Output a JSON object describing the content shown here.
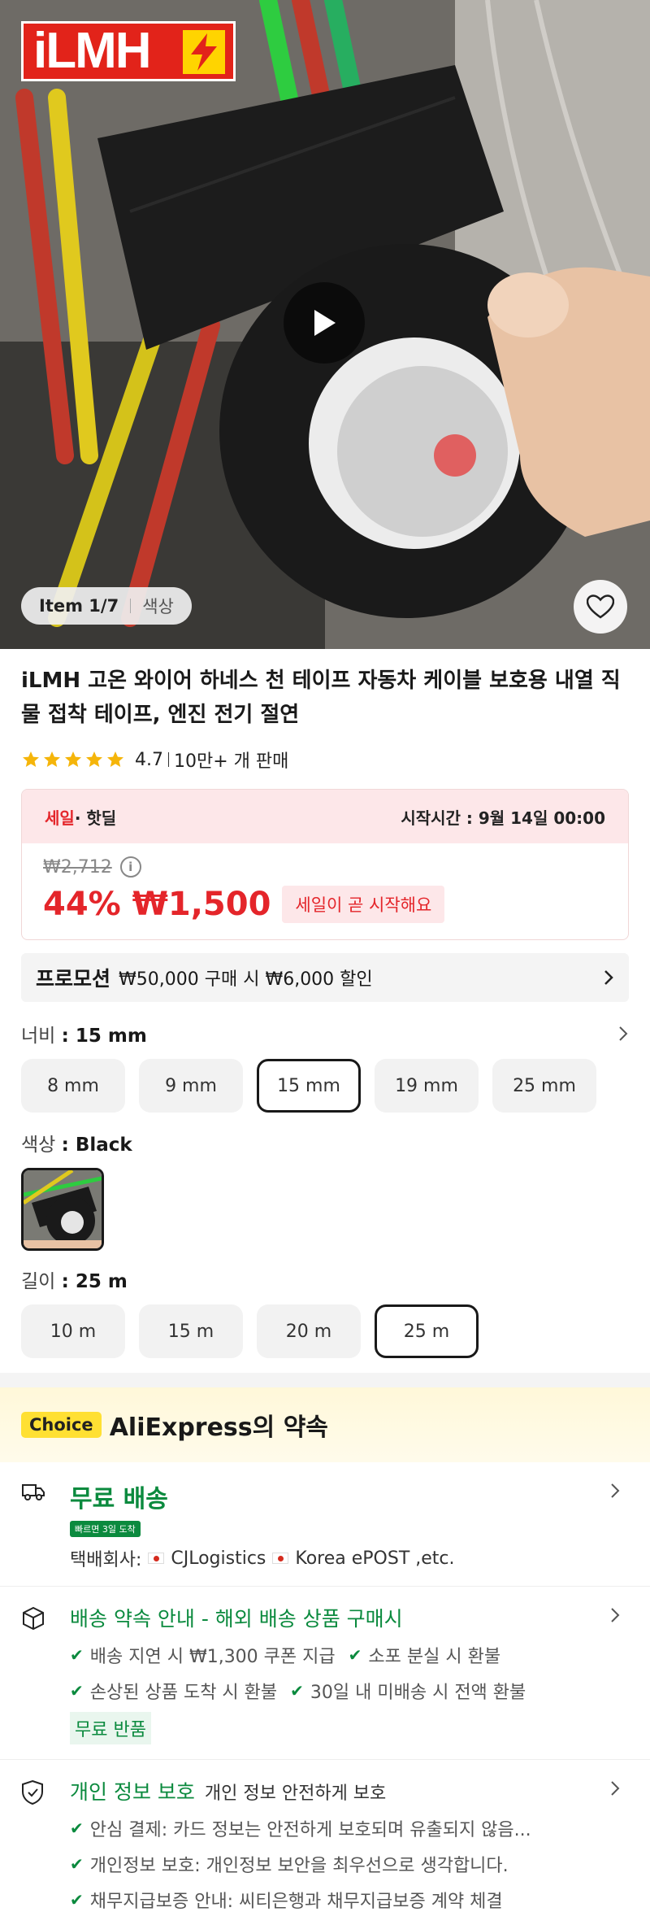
{
  "hero": {
    "brand_logo_text": "iLMH",
    "item_index": "Item 1/7",
    "item_label": "색상"
  },
  "product": {
    "title": "iLMH 고온 와이어 하네스 천 테이프 자동차 케이블 보호용 내열 직물 접착 테이프, 엔진 전기 절연",
    "rating": "4.7",
    "sold": "10만+ 개 판매"
  },
  "sale": {
    "tag_main": "세일",
    "tag_sub": "· 핫딜",
    "start_time": "시작시간 : 9월 14일 00:00",
    "original_price": "₩2,712",
    "discount": "44%",
    "price": "₩1,500",
    "status": "세일이 곧 시작해요"
  },
  "promo": {
    "tag": "프로모션",
    "text": "₩50,000 구매 시 ₩6,000 할인"
  },
  "options": {
    "width_label": "너비",
    "width_value": ": 15 mm",
    "widths": [
      "8 mm",
      "9 mm",
      "15 mm",
      "19 mm",
      "25 mm"
    ],
    "color_label": "색상",
    "color_value": ": Black",
    "length_label": "길이",
    "length_value": ": 25 m",
    "lengths": [
      "10 m",
      "15 m",
      "20 m",
      "25 m"
    ]
  },
  "choice": {
    "badge": "Choice",
    "title": "AliExpress의 약속"
  },
  "shipping": {
    "title": "무료 배송",
    "fast_badge": "빠르면 3일 도착",
    "carrier_label": "택배회사:",
    "carrier1": "CJLogistics",
    "carrier2": "Korea ePOST ,etc."
  },
  "delivery": {
    "title": "배송 약속 안내 - 해외 배송 상품 구매시",
    "items": [
      "배송 지연 시 ₩1,300 쿠폰 지급",
      "소포 분실 시 환불",
      "손상된 상품 도착 시 환불",
      "30일 내 미배송 시 전액 환불"
    ],
    "free_return": "무료 반품"
  },
  "privacy": {
    "title": "개인 정보 보호",
    "subtitle": "개인 정보 안전하게 보호",
    "items": [
      "안심 결제: 카드 정보는 안전하게 보호되며 유출되지 않음...",
      "개인정보 보호: 개인정보 보안을 최우선으로 생각합니다.",
      "채무지급보증 안내: 씨티은행과 채무지급보증 계약 체결"
    ]
  },
  "colors": {
    "sale_red": "#e4252a",
    "choice_yellow": "#ffe033",
    "success_green": "#0b8a3e"
  }
}
